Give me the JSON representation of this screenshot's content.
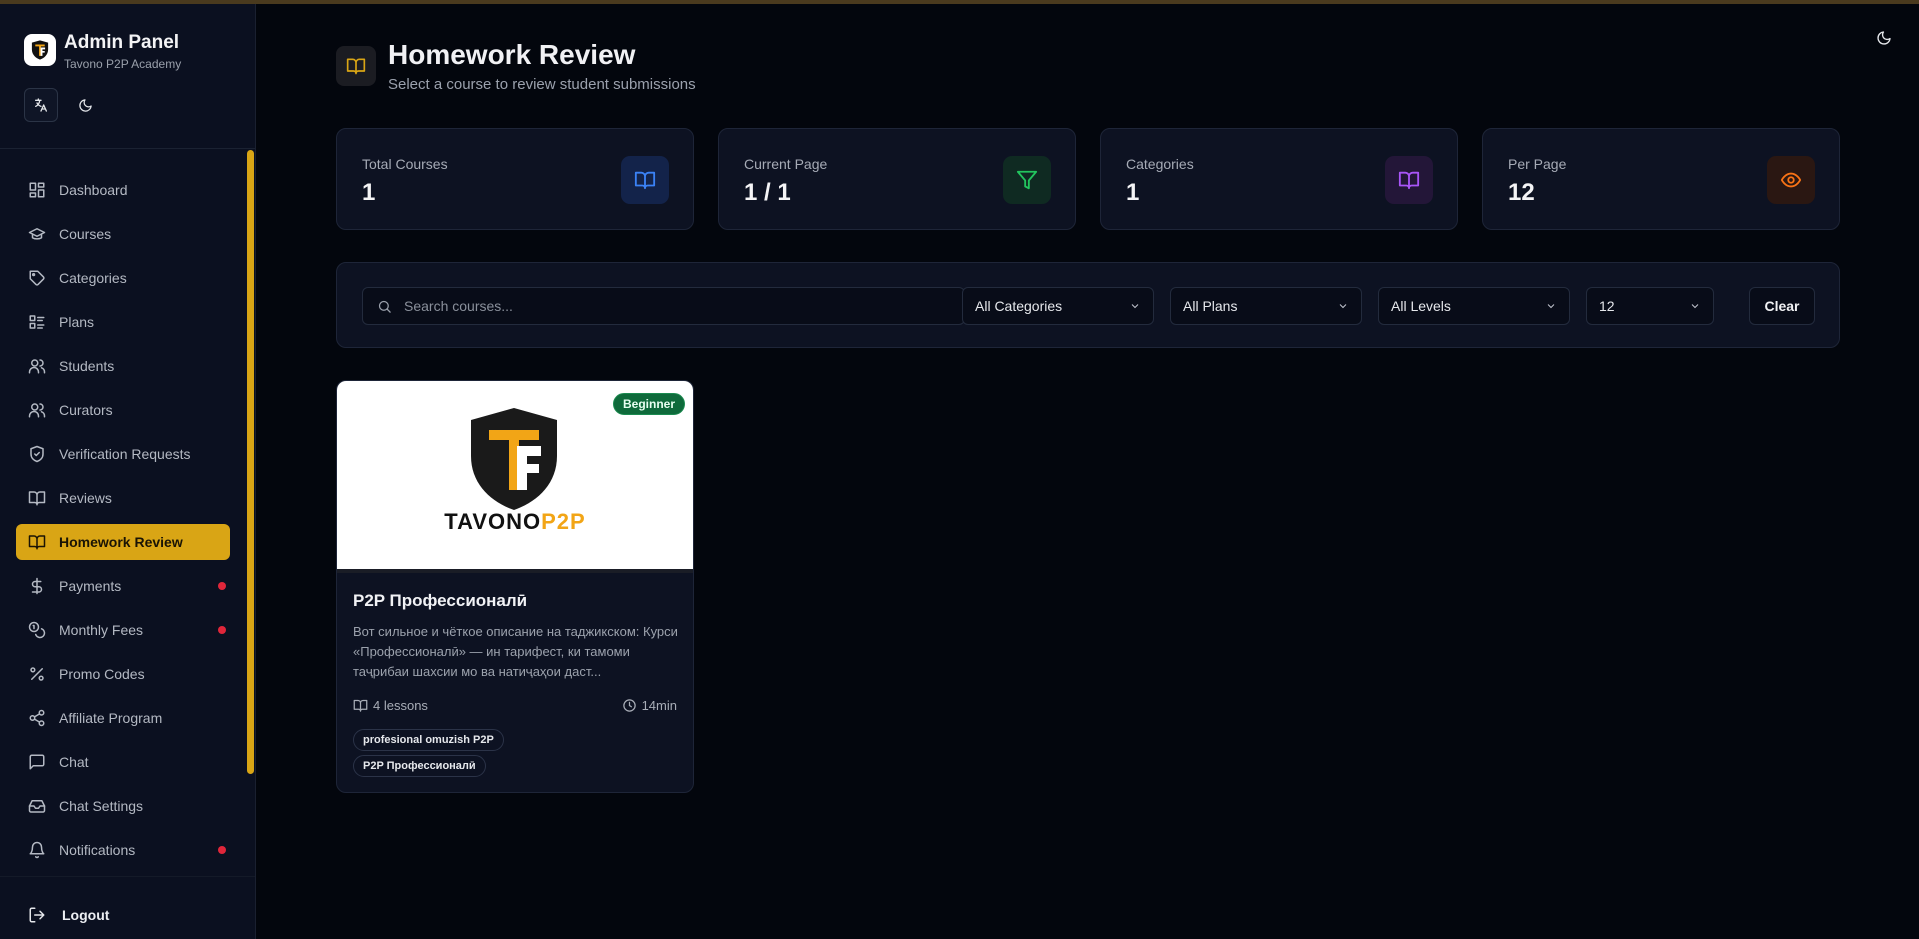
{
  "app": {
    "title": "Admin Panel",
    "subtitle": "Tavono P2P Academy",
    "logo_text": "TAVONO P2P"
  },
  "sidebar": {
    "items": [
      {
        "label": "Dashboard",
        "icon": "dashboard-icon",
        "active": false,
        "dot": false
      },
      {
        "label": "Courses",
        "icon": "graduation-cap-icon",
        "active": false,
        "dot": false
      },
      {
        "label": "Categories",
        "icon": "tag-icon",
        "active": false,
        "dot": false
      },
      {
        "label": "Plans",
        "icon": "list-icon",
        "active": false,
        "dot": false
      },
      {
        "label": "Students",
        "icon": "users-icon",
        "active": false,
        "dot": false
      },
      {
        "label": "Curators",
        "icon": "users-icon",
        "active": false,
        "dot": false
      },
      {
        "label": "Verification Requests",
        "icon": "shield-check-icon",
        "active": false,
        "dot": false
      },
      {
        "label": "Reviews",
        "icon": "book-open-icon",
        "active": false,
        "dot": false
      },
      {
        "label": "Homework Review",
        "icon": "book-open-icon",
        "active": true,
        "dot": false
      },
      {
        "label": "Payments",
        "icon": "dollar-icon",
        "active": false,
        "dot": true
      },
      {
        "label": "Monthly Fees",
        "icon": "coins-icon",
        "active": false,
        "dot": true
      },
      {
        "label": "Promo Codes",
        "icon": "percent-icon",
        "active": false,
        "dot": false
      },
      {
        "label": "Affiliate Program",
        "icon": "share-icon",
        "active": false,
        "dot": false
      },
      {
        "label": "Chat",
        "icon": "chat-icon",
        "active": false,
        "dot": false
      },
      {
        "label": "Chat Settings",
        "icon": "inbox-icon",
        "active": false,
        "dot": false
      },
      {
        "label": "Notifications",
        "icon": "bell-icon",
        "active": false,
        "dot": true
      }
    ],
    "logout_label": "Logout",
    "accent": "#d9a515",
    "dot_color": "#e0263a"
  },
  "page": {
    "title": "Homework Review",
    "subtitle": "Select a course to review student submissions"
  },
  "stats": [
    {
      "label": "Total Courses",
      "value": "1",
      "icon": "book-open-icon",
      "color": "#3b82f6",
      "bg": "#13234a"
    },
    {
      "label": "Current Page",
      "value": "1 / 1",
      "icon": "filter-icon",
      "color": "#22c55e",
      "bg": "#0f2a22"
    },
    {
      "label": "Categories",
      "value": "1",
      "icon": "book-open-icon",
      "color": "#a855f7",
      "bg": "#231638"
    },
    {
      "label": "Per Page",
      "value": "12",
      "icon": "eye-icon",
      "color": "#f97316",
      "bg": "#2a1712"
    }
  ],
  "filters": {
    "search_placeholder": "Search courses...",
    "search_value": "",
    "category": "All Categories",
    "plan": "All Plans",
    "level": "All Levels",
    "per_page": "12",
    "clear_label": "Clear"
  },
  "courses": [
    {
      "title": "P2P Профессионалӣ",
      "level_badge": "Beginner",
      "description": "Вот сильное и чёткое описание на таджикском: Курси «Профессионалӣ» — ин тарифест, ки тамоми таҷрибаи шахсии мо ва натиҷаҳои даст...",
      "lessons": "4 lessons",
      "duration": "14min",
      "tags": [
        "profesional omuzish P2P",
        "P2P Профессионалӣ"
      ],
      "thumb_brand_a": "TAVONO",
      "thumb_brand_b": "P2P"
    }
  ]
}
